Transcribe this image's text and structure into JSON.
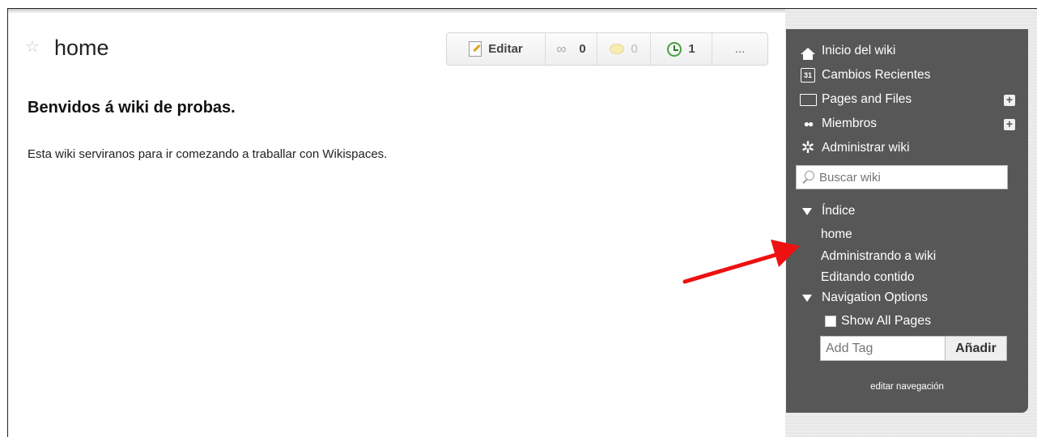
{
  "page": {
    "title": "home",
    "star_icon": "star-outline-icon"
  },
  "toolbar": {
    "edit_label": "Editar",
    "links_count": "0",
    "comments_count": "0",
    "history_count": "1",
    "more_label": "..."
  },
  "content": {
    "heading": "Benvidos á wiki de probas.",
    "paragraph": "Esta wiki serviranos para ir comezando a traballar con Wikispaces."
  },
  "sidebar": {
    "nav": [
      {
        "label": "Inicio del wiki",
        "icon": "home-icon"
      },
      {
        "label": "Cambios Recientes",
        "icon": "calendar-icon",
        "icon_text": "31"
      },
      {
        "label": "Pages and Files",
        "icon": "folder-icon"
      },
      {
        "label": "Miembros",
        "icon": "members-icon"
      },
      {
        "label": "Administrar wiki",
        "icon": "gear-icon"
      }
    ],
    "search_placeholder": "Buscar wiki",
    "index": {
      "label": "Índice",
      "items": [
        "home",
        "Administrando a wiki",
        "Editando contido"
      ]
    },
    "navigation_options": {
      "label": "Navigation Options",
      "show_all_pages": "Show All Pages"
    },
    "tag_placeholder": "Add Tag",
    "add_button": "Añadir",
    "edit_navigation": "editar navegación"
  },
  "colors": {
    "sidebar_bg": "#575757",
    "annotation_arrow": "#ee1111"
  }
}
